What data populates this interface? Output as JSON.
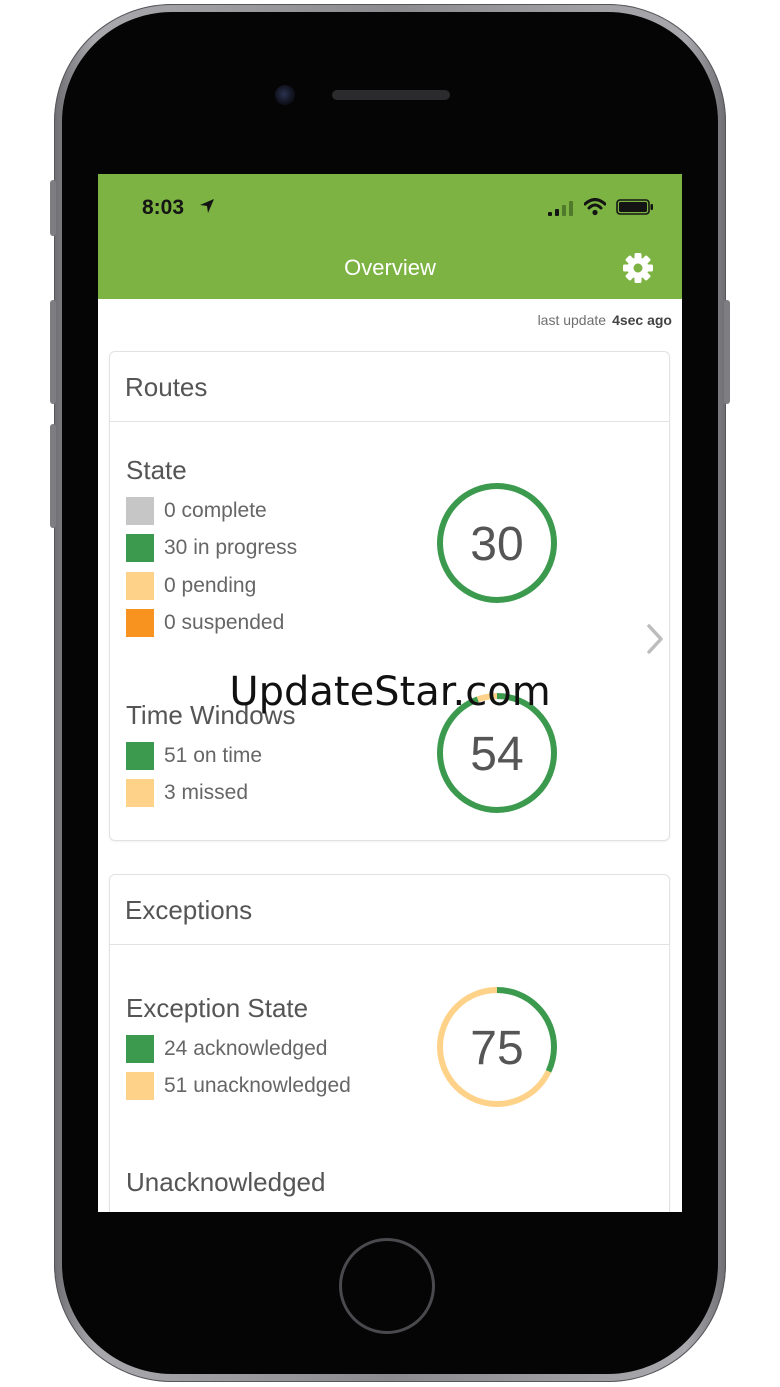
{
  "status_bar": {
    "time": "8:03"
  },
  "nav": {
    "title": "Overview"
  },
  "last_update": {
    "label": "last update",
    "value": "4sec ago"
  },
  "routes_card": {
    "header": "Routes",
    "state": {
      "title": "State",
      "items": [
        {
          "label": "0 complete",
          "color": "#c6c6c6"
        },
        {
          "label": "30 in progress",
          "color": "#3c9a4e"
        },
        {
          "label": "0 pending",
          "color": "#ffd28a"
        },
        {
          "label": "0 suspended",
          "color": "#f7931e"
        }
      ],
      "total": "30",
      "segments": [
        {
          "value": 30,
          "color": "#3c9a4e"
        }
      ]
    },
    "time_windows": {
      "title": "Time Windows",
      "items": [
        {
          "label": "51 on time",
          "color": "#3c9a4e"
        },
        {
          "label": "3 missed",
          "color": "#ffd28a"
        }
      ],
      "total": "54",
      "segments": [
        {
          "value": 51,
          "color": "#3c9a4e"
        },
        {
          "value": 3,
          "color": "#ffd28a"
        }
      ]
    }
  },
  "exceptions_card": {
    "header": "Exceptions",
    "exception_state": {
      "title": "Exception State",
      "items": [
        {
          "label": "24 acknowledged",
          "color": "#3c9a4e"
        },
        {
          "label": "51 unacknowledged",
          "color": "#ffd28a"
        }
      ],
      "total": "75",
      "segments": [
        {
          "value": 24,
          "color": "#3c9a4e"
        },
        {
          "value": 51,
          "color": "#ffd28a"
        }
      ]
    },
    "unacknowledged_title": "Unacknowledged"
  },
  "watermark": "UpdateStar.com",
  "colors": {
    "header_green": "#7cb342",
    "donut_green": "#3c9a4e",
    "donut_yellow": "#ffd28a"
  }
}
